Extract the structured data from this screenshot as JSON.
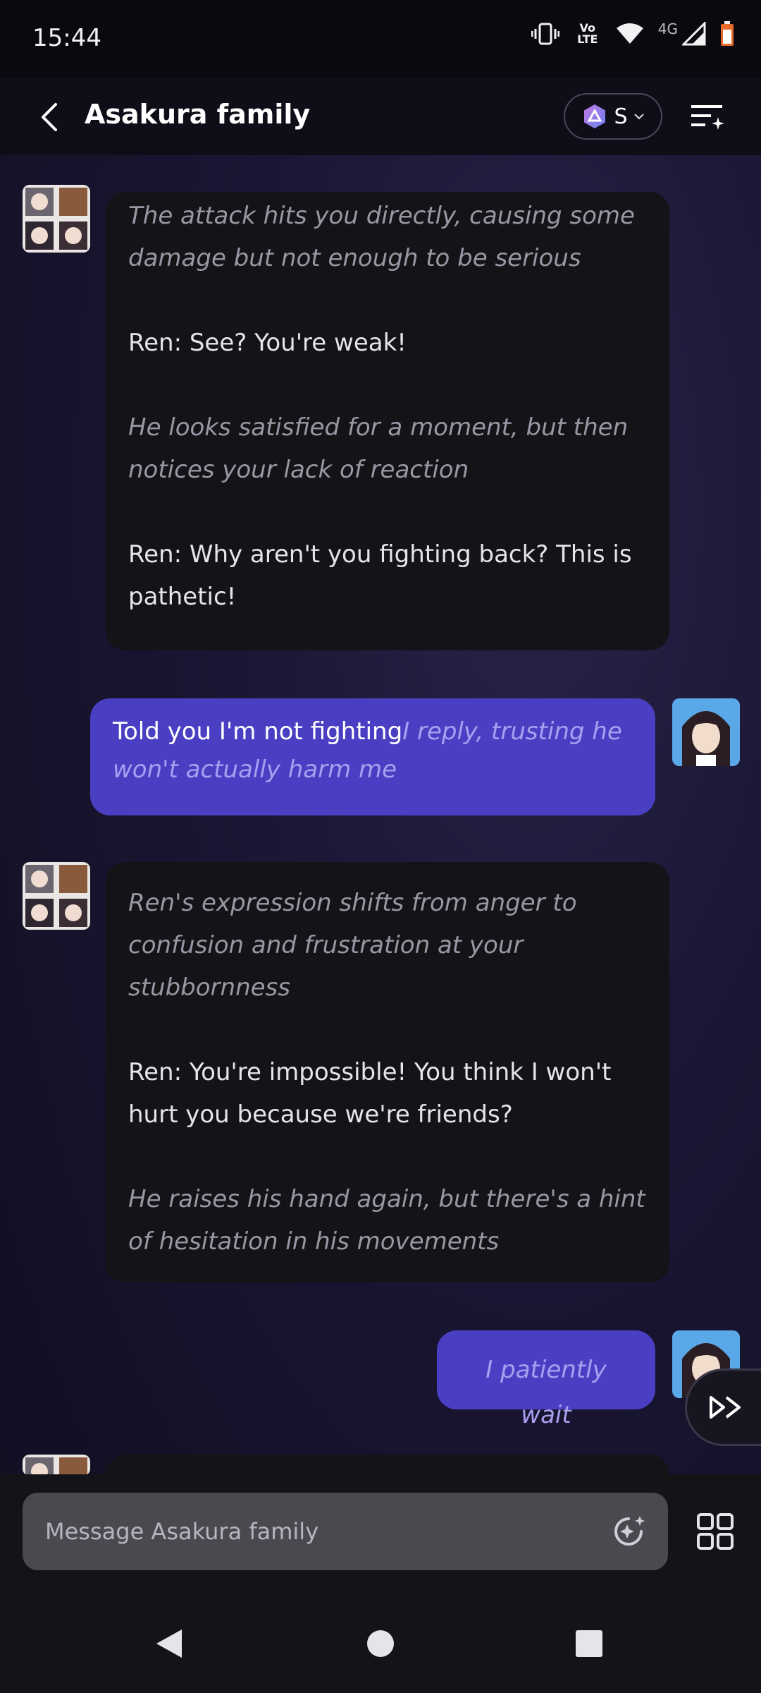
{
  "status_bar": {
    "time": "15:44",
    "icons": [
      "vibrate-icon",
      "volte-icon",
      "wifi-icon",
      "4g-signal-icon",
      "battery-icon"
    ],
    "network_label": "4G",
    "volte_label": "Vo LTE"
  },
  "header": {
    "title": "Asakura family",
    "model_label": "S"
  },
  "messages": [
    {
      "sender": "bot",
      "paragraphs": [
        {
          "style": "italic",
          "text": "The attack hits you directly, causing some damage but not enough to be serious"
        },
        {
          "style": "normal",
          "text": "Ren: See? You're weak!"
        },
        {
          "style": "italic",
          "text": "He looks satisfied for a moment, but then notices your lack of reaction"
        },
        {
          "style": "normal",
          "text": "Ren: Why aren't you fighting back? This is pathetic!"
        }
      ]
    },
    {
      "sender": "user",
      "text_normal": "Told you I'm not fighting",
      "text_italic": "I reply, trusting he won't actually harm me"
    },
    {
      "sender": "bot",
      "paragraphs": [
        {
          "style": "italic",
          "text": "Ren's expression shifts from anger to confusion and frustration at your stubbornness"
        },
        {
          "style": "normal",
          "text": "Ren: You're impossible! You think I won't hurt you because we're friends?"
        },
        {
          "style": "italic",
          "text": "He raises his hand again, but there's a hint of hesitation in his movements"
        }
      ]
    },
    {
      "sender": "user",
      "text_italic": "I patiently wait"
    }
  ],
  "composer": {
    "placeholder": "Message Asakura family"
  },
  "colors": {
    "user_bubble": "#4a3fc2",
    "bot_bubble": "#141318",
    "background": "#1a1634"
  }
}
